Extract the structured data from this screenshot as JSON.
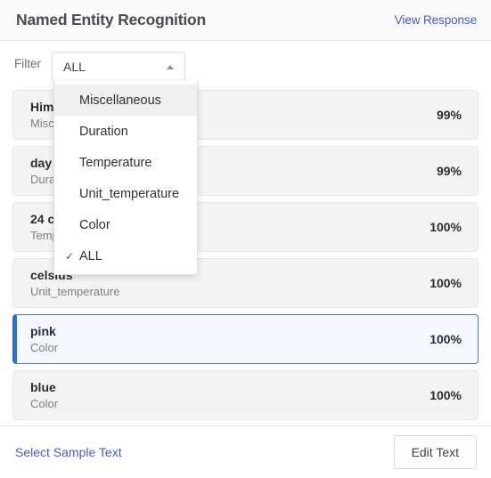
{
  "header": {
    "title": "Named Entity Recognition",
    "link_label": "View Response"
  },
  "filter": {
    "label": "Filter",
    "selected_value": "ALL",
    "caret_icon": "caret-up-icon",
    "expanded": true,
    "options": [
      {
        "label": "Miscellaneous",
        "checked": false,
        "hovered": true
      },
      {
        "label": "Duration",
        "checked": false,
        "hovered": false
      },
      {
        "label": "Temperature",
        "checked": false,
        "hovered": false
      },
      {
        "label": "Unit_temperature",
        "checked": false,
        "hovered": false
      },
      {
        "label": "Color",
        "checked": false,
        "hovered": false
      },
      {
        "label": "ALL",
        "checked": true,
        "hovered": false
      }
    ],
    "check_glyph": "✓"
  },
  "entities": [
    {
      "name": "Him",
      "type": "Misc",
      "score": "99%",
      "selected": false
    },
    {
      "name": "day",
      "type": "Dura",
      "score": "99%",
      "selected": false
    },
    {
      "name": "24 c",
      "type": "Temp",
      "score": "100%",
      "selected": false
    },
    {
      "name": "celsius",
      "type": "Unit_temperature",
      "score": "100%",
      "selected": false
    },
    {
      "name": "pink",
      "type": "Color",
      "score": "100%",
      "selected": true
    },
    {
      "name": "blue",
      "type": "Color",
      "score": "100%",
      "selected": false
    }
  ],
  "footer": {
    "link_label": "Select Sample Text",
    "button_label": "Edit Text"
  },
  "colors": {
    "accent_blue": "#2f6fd0",
    "link_blue": "#4a5bbd",
    "row_bg": "#f4f4f5",
    "selected_row_bg": "#f5f9ff",
    "header_bg": "#fafafa"
  }
}
